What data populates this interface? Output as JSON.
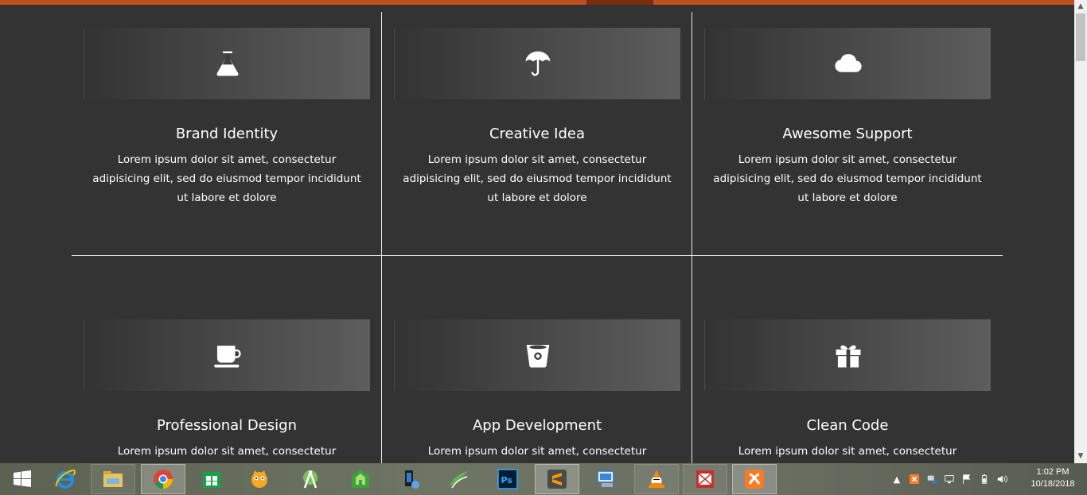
{
  "features": [
    {
      "title": "Brand Identity",
      "description": "Lorem ipsum dolor sit amet, consectetur adipisicing elit, sed do eiusmod tempor incididunt ut labore et dolore",
      "icon": "flask-icon"
    },
    {
      "title": "Creative Idea",
      "description": "Lorem ipsum dolor sit amet, consectetur adipisicing elit, sed do eiusmod tempor incididunt ut labore et dolore",
      "icon": "umbrella-icon"
    },
    {
      "title": "Awesome Support",
      "description": "Lorem ipsum dolor sit amet, consectetur adipisicing elit, sed do eiusmod tempor incididunt ut labore et dolore",
      "icon": "cloud-icon"
    },
    {
      "title": "Professional Design",
      "description": "Lorem ipsum dolor sit amet, consectetur adipisicing",
      "icon": "coffee-cup-icon"
    },
    {
      "title": "App Development",
      "description": "Lorem ipsum dolor sit amet, consectetur adipisicing",
      "icon": "bucket-icon"
    },
    {
      "title": "Clean Code",
      "description": "Lorem ipsum dolor sit amet, consectetur adipisicing",
      "icon": "gift-icon"
    }
  ],
  "taskbar": {
    "apps": [
      "windows-start-icon",
      "internet-explorer-icon",
      "file-explorer-icon",
      "chrome-icon",
      "store-icon",
      "scratch-icon",
      "android-studio-icon",
      "home-app-icon",
      "phone-link-icon",
      "sketchup-icon",
      "photoshop-icon",
      "sublime-text-icon",
      "remote-desktop-icon",
      "vlc-icon",
      "mail-app-icon",
      "xampp-icon"
    ],
    "clock_time": "1:02 PM",
    "clock_date": "10/18/2018"
  },
  "colors": {
    "accent": "#c1501f",
    "background": "#333333"
  }
}
